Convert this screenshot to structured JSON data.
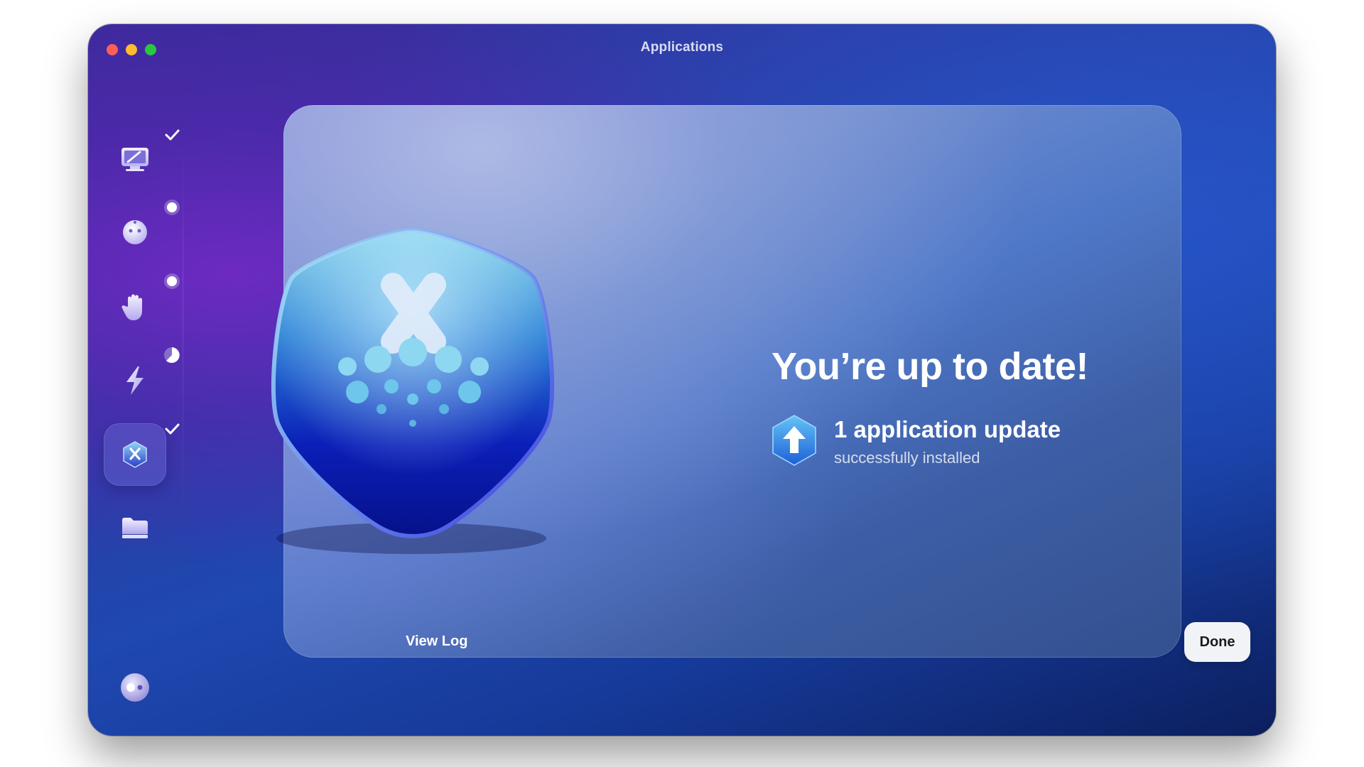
{
  "window": {
    "title": "Applications"
  },
  "sidebar": {
    "items": [
      {
        "icon": "system-junk-icon",
        "status": "checkmark-icon"
      },
      {
        "icon": "protection-icon",
        "status": "pending-dot-icon"
      },
      {
        "icon": "privacy-icon",
        "status": "pending-dot-icon"
      },
      {
        "icon": "speed-icon",
        "status": "progress-pie-icon"
      },
      {
        "icon": "applications-icon",
        "status": "checkmark-icon",
        "active": true
      },
      {
        "icon": "files-icon",
        "status": ""
      }
    ],
    "footer_icon": "assistant-toggle-icon"
  },
  "main": {
    "headline": "You’re up to date!",
    "update_count": "1 application update",
    "update_status": "successfully installed",
    "view_log_label": "View Log",
    "done_label": "Done"
  },
  "colors": {
    "traffic_red": "#fe5f57",
    "traffic_yellow": "#febc2e",
    "traffic_green": "#28c840",
    "accent_blue": "#2f7fe0"
  }
}
